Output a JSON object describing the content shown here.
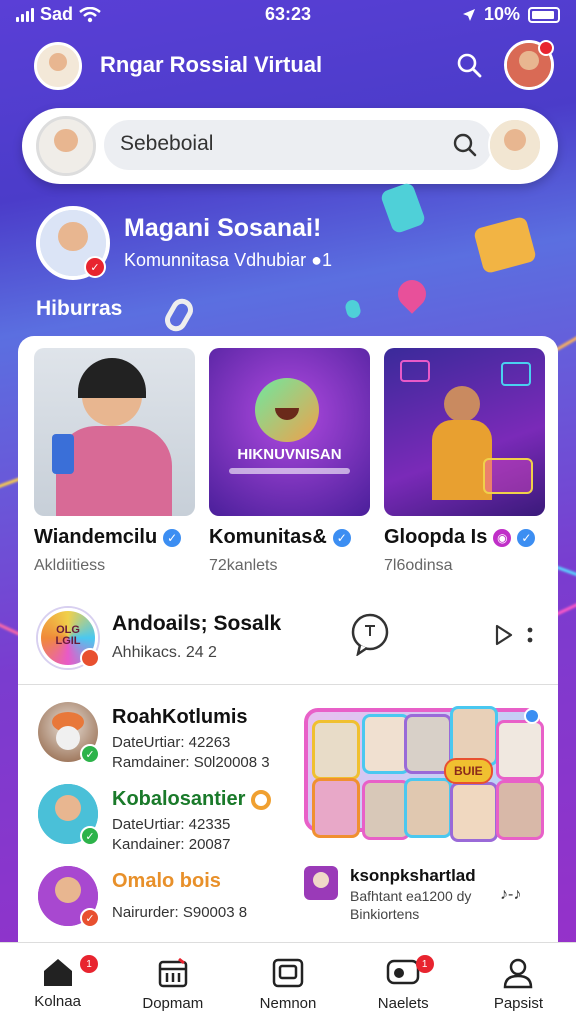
{
  "status_bar": {
    "carrier": "Sad",
    "time": "63:23",
    "battery": "10%"
  },
  "header": {
    "title": "Rngar Rossial Virtual"
  },
  "search": {
    "placeholder": "Sebeboial"
  },
  "profile": {
    "name": "Magani Sosanai!",
    "subtitle": "Komunnitasa Vdhubiar ●1"
  },
  "section": {
    "title": "Hiburras"
  },
  "tiles": [
    {
      "name": "Wiandemcilu",
      "sub": "Akldiitiess",
      "verify_color": "#3c8ef2"
    },
    {
      "name": "Komunitas&",
      "sub": "72kanlets",
      "verify_color": "#3c8ef2",
      "banner": "HIKNUVNISAN"
    },
    {
      "name": "Gloopda Is",
      "sub": "7l6odinsa",
      "verify_color": "#3c8ef2",
      "extra_dot_color": "#c02fc8"
    }
  ],
  "community": {
    "title": "Andoails; Sosalk",
    "subtitle": "Ahhikacs. 24 2",
    "logo_text": "OLG LGIL"
  },
  "list": [
    {
      "title": "RoahKotlumis",
      "title_highlight": "s",
      "line1": "DateUrtiar: 42263",
      "line2": "Ramdainer: S0l20008 3",
      "check_color": "#2db34a"
    },
    {
      "title": "Kobalosantier",
      "line1": "DateUrtiar: 42335",
      "line2": "Kandainer: 20087",
      "check_color": "#2db34a"
    },
    {
      "title": "Omalo bois",
      "line1": "Nairurder: S90003 8",
      "line2": "",
      "check_color": "#e8242f"
    }
  ],
  "collage": {
    "sticker_text": "BUIE"
  },
  "mini_item": {
    "title": "ksonpkshartlad",
    "line1": "Bafhtant ea1200 dy",
    "line2": "Binkiortens",
    "music_icon": "♪-♪"
  },
  "bottom_nav": [
    {
      "label": "Kolnaa",
      "icon": "home-icon",
      "badge": "1"
    },
    {
      "label": "Dopmam",
      "icon": "calendar-icon",
      "badge": ""
    },
    {
      "label": "Nemnon",
      "icon": "media-icon",
      "badge": ""
    },
    {
      "label": "Naelets",
      "icon": "chat-icon",
      "badge": "1"
    },
    {
      "label": "Papsist",
      "icon": "profile-icon",
      "badge": ""
    }
  ],
  "colors": {
    "accent_purple": "#6a3fd6",
    "badge_red": "#e8242f",
    "verify_blue": "#3c8ef2"
  }
}
